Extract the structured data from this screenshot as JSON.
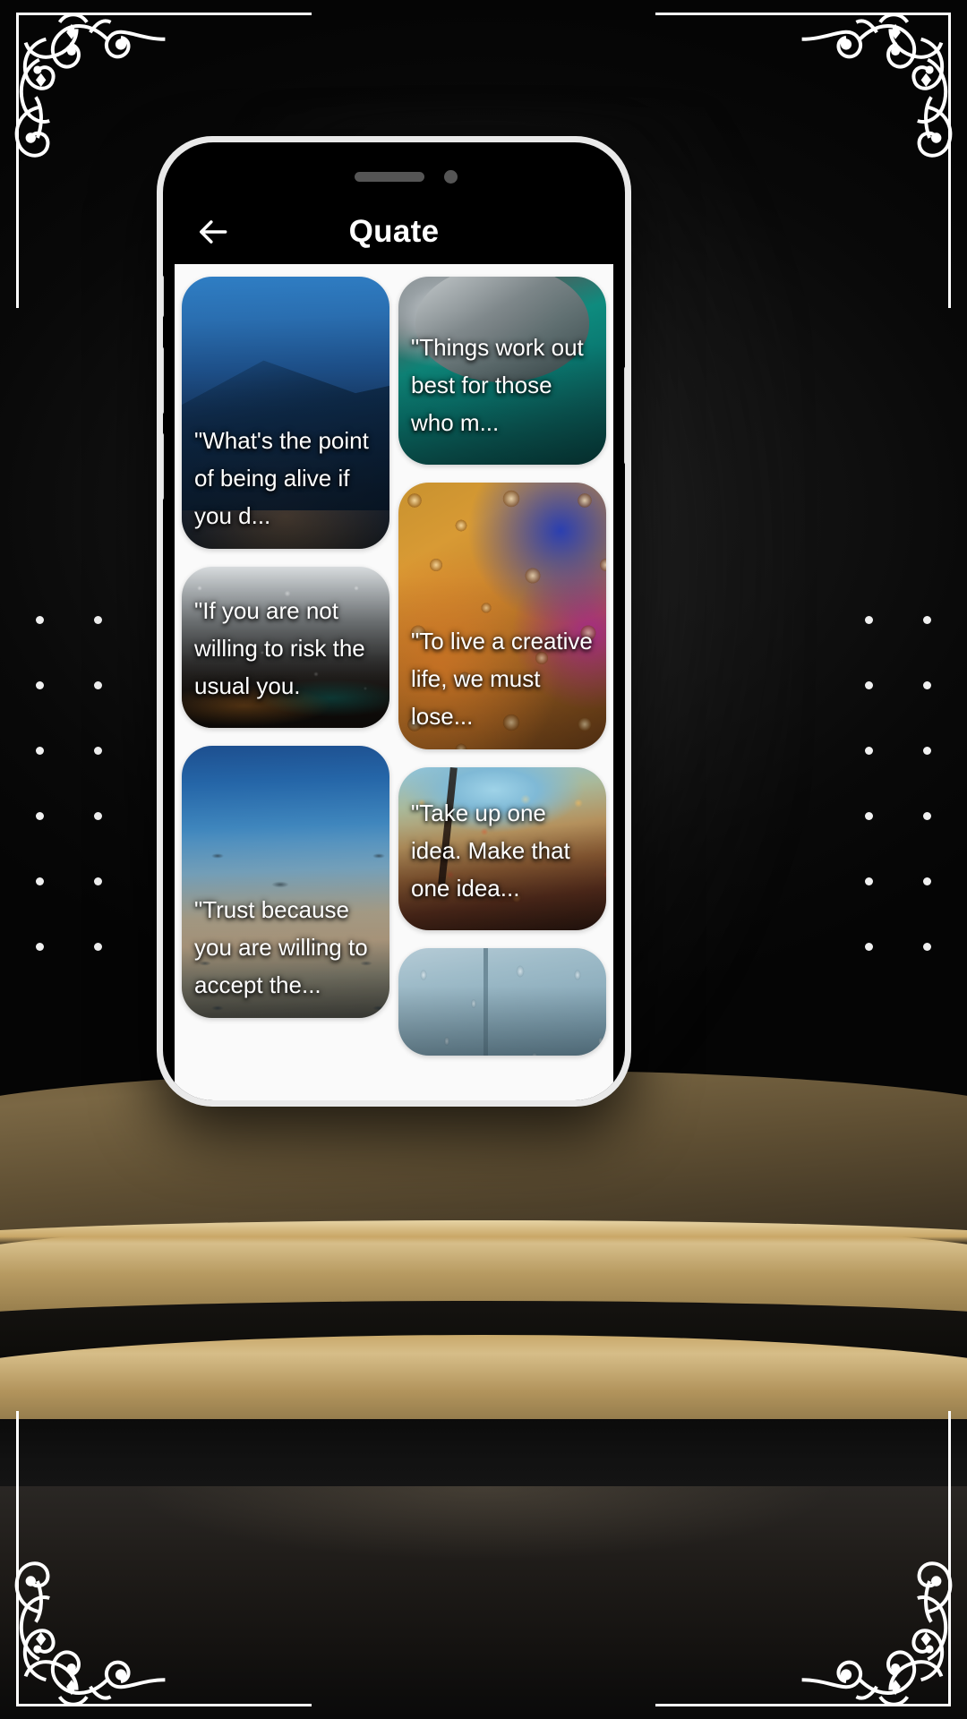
{
  "app": {
    "title": "Quate",
    "back_icon": "arrow-left-icon"
  },
  "status_bar": {
    "dynamic_island_pill": "island-pill",
    "camera_dot": "camera-dot"
  },
  "quotes": {
    "left_column": [
      {
        "id": "quote-whats-the-point",
        "text": "\"What's the point of being alive if you d...",
        "art": "art-night-bridge"
      },
      {
        "id": "quote-if-you-are-not-willing",
        "text": "\"If you are not willing to risk the usual you.",
        "art": "art-rain-city"
      },
      {
        "id": "quote-trust-because",
        "text": "\"Trust because you are willing to accept the...",
        "art": "art-sea-dawn"
      }
    ],
    "right_column": [
      {
        "id": "quote-things-work-out",
        "text": "\"Things work out best for those who m...",
        "art": "art-teal-rope"
      },
      {
        "id": "quote-to-live-a-creative-life",
        "text": "\"To live a creative life, we must lose...",
        "art": "art-drops-gold"
      },
      {
        "id": "quote-take-up-one-idea",
        "text": "\"Take up one idea. Make that one idea...",
        "art": "art-autumn-paint"
      },
      {
        "id": "quote-window-rain-partial",
        "text": "",
        "art": "art-window-rain"
      }
    ]
  },
  "colors": {
    "app_bar_background": "#000000",
    "screen_background": "#fafafa",
    "title_text": "#ffffff",
    "phone_frame": "#e9e9e9",
    "podium_gold": "#c8a86a",
    "ornament_white": "#ffffff"
  }
}
